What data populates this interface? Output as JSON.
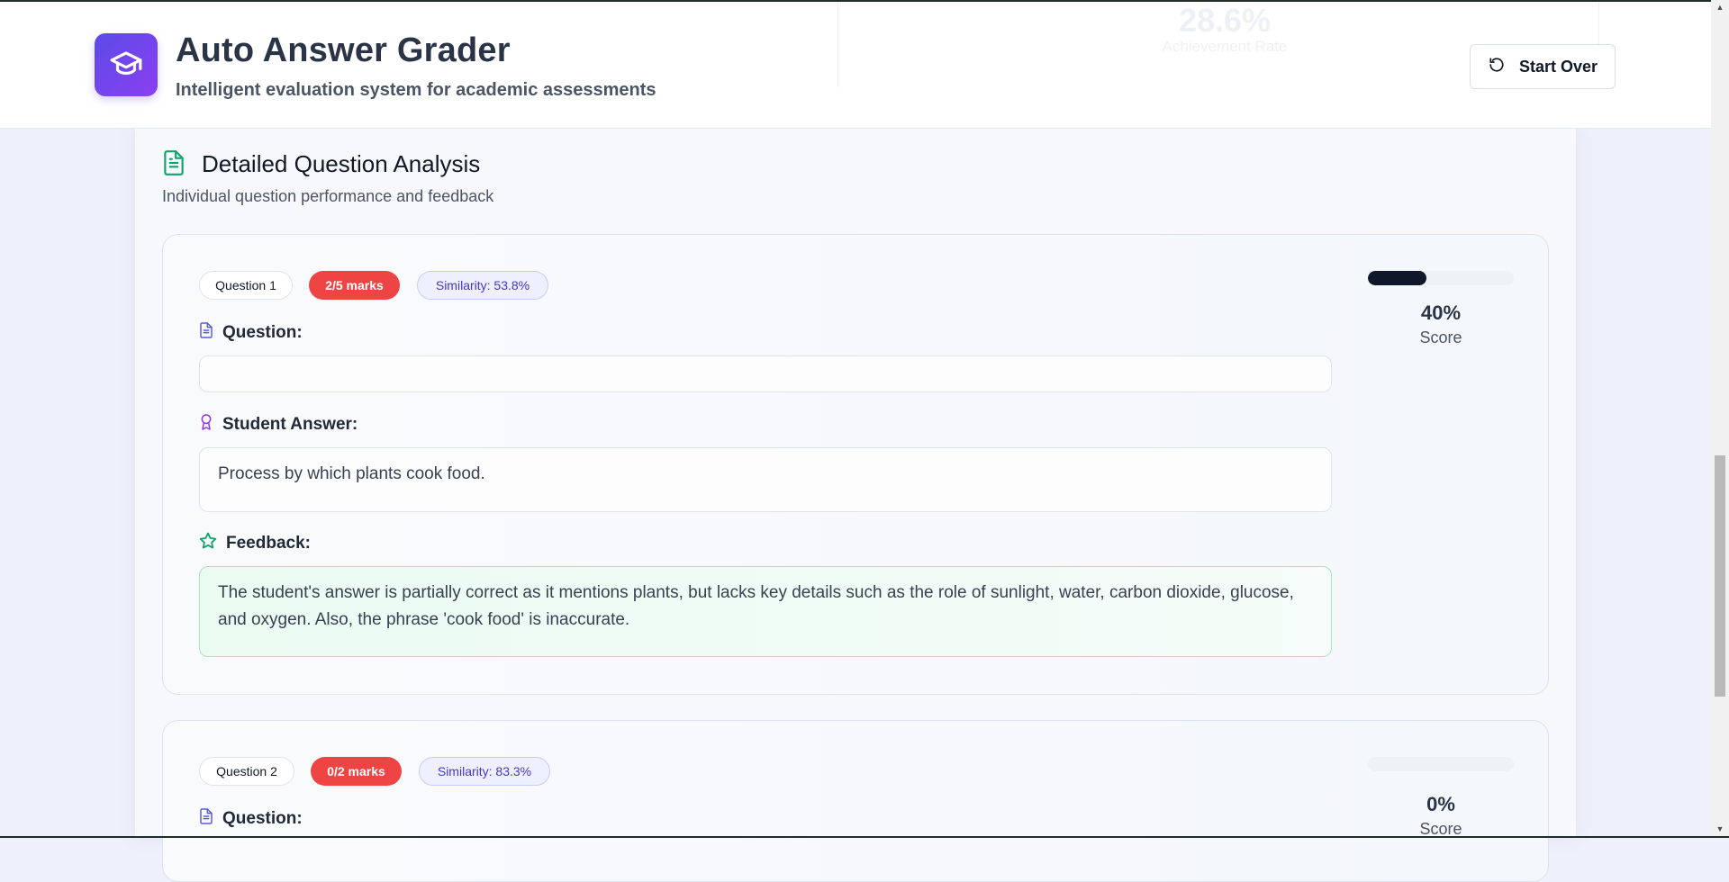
{
  "header": {
    "title": "Auto Answer Grader",
    "subtitle": "Intelligent evaluation system for academic assessments",
    "start_over_label": "Start Over",
    "ghost_stat_value": "28.6%",
    "ghost_stat_label": "Achievement Rate"
  },
  "section": {
    "title": "Detailed Question Analysis",
    "subtitle": "Individual question performance and feedback"
  },
  "questions": [
    {
      "label": "Question 1",
      "marks": "2/5 marks",
      "similarity": "Similarity: 53.8%",
      "question_label": "Question:",
      "question_text": "",
      "answer_label": "Student Answer:",
      "answer_text": "Process by which plants cook food.",
      "feedback_label": "Feedback:",
      "feedback_text": "The student's answer is partially correct as it mentions plants, but lacks key details such as the role of sunlight, water, carbon dioxide, glucose, and oxygen. Also, the phrase 'cook food' is inaccurate.",
      "score_percent": "40%",
      "score_fraction": 0.4,
      "score_label": "Score"
    },
    {
      "label": "Question 2",
      "marks": "0/2 marks",
      "similarity": "Similarity: 83.3%",
      "question_label": "Question:",
      "score_percent": "0%",
      "score_fraction": 0,
      "score_label": "Score"
    }
  ],
  "colors": {
    "accent": "#6d4aeb",
    "marks_badge": "#ee4444",
    "feedback_border": "#a7e6c4",
    "score_fill": "#0f172a",
    "section_icon": "#10a36b"
  },
  "icons": {
    "logo": "graduation-cap-icon",
    "start_over": "rotate-ccw-icon",
    "section": "file-text-icon",
    "question": "file-text-icon",
    "answer": "award-icon",
    "feedback": "star-icon"
  }
}
